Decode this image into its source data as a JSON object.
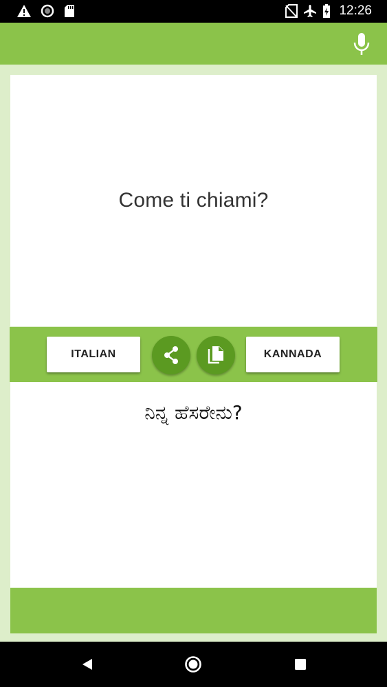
{
  "status_bar": {
    "time": "12:26",
    "left_icons": [
      "warning-icon",
      "circle-status-icon",
      "sd-card-icon"
    ],
    "right_icons": [
      "no-sim-icon",
      "airplane-icon",
      "battery-charging-icon"
    ]
  },
  "app_bar": {
    "mic_icon": "microphone-icon"
  },
  "translator": {
    "source_text": "Come ti chiami?",
    "target_text": "ನಿನ್ನ ಹೆಸರೇನು?",
    "source_language": "ITALIAN",
    "target_language": "KANNADA",
    "share_icon": "share-icon",
    "copy_icon": "copy-icon"
  },
  "colors": {
    "accent": "#8bc34a",
    "accent_dark": "#5b9a21",
    "background": "#ddeeca"
  },
  "nav_bar": {
    "icons": [
      "back-icon",
      "home-icon",
      "recents-icon"
    ]
  }
}
